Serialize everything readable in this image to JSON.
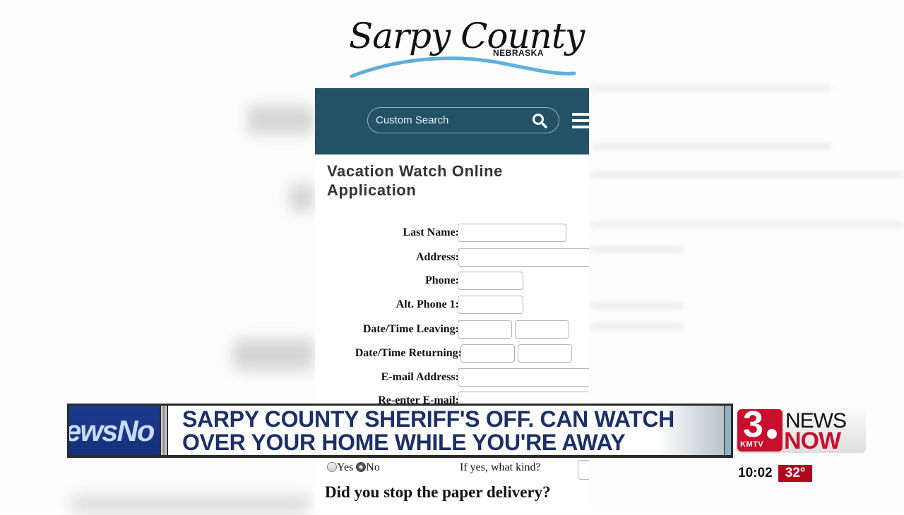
{
  "site": {
    "logo_title": "Sarpy County",
    "logo_subtitle": "NEBRASKA",
    "search_placeholder": "Custom Search",
    "page_title": "Vacation Watch Online Application"
  },
  "form": {
    "fields": [
      {
        "label": "Last Name:",
        "value": ""
      },
      {
        "label": "Address:",
        "value": ""
      },
      {
        "label": "Phone:",
        "value": ""
      },
      {
        "label": "Alt. Phone 1:",
        "value": ""
      },
      {
        "label": "Date/Time Leaving:",
        "value": "",
        "value2": ""
      },
      {
        "label": "Date/Time Returning:",
        "value": "",
        "value2": ""
      },
      {
        "label": "E-mail Address:",
        "value": ""
      },
      {
        "label": "Re-enter E-mail:",
        "value": ""
      }
    ],
    "radio_yes": "Yes",
    "radio_no": "No",
    "radio_selected": "No",
    "if_yes_label": "If yes, what kind?",
    "paper_question": "Did you stop the paper delivery?"
  },
  "broadcast": {
    "left_panel_text": "ewsNo",
    "headline_line1": "SARPY COUNTY SHERIFF'S OFF. CAN WATCH",
    "headline_line2": "OVER YOUR HOME WHILE YOU'RE AWAY",
    "station_number": "3",
    "station_call": "KMTV",
    "brand_top": "NEWS",
    "brand_bottom": "NOW",
    "time": "10:02",
    "temperature": "32°",
    "colors": {
      "headline": "#1b2f68",
      "station_red": "#c8102e",
      "temp_bg": "#b1061c",
      "nav_bg": "#235267"
    }
  }
}
